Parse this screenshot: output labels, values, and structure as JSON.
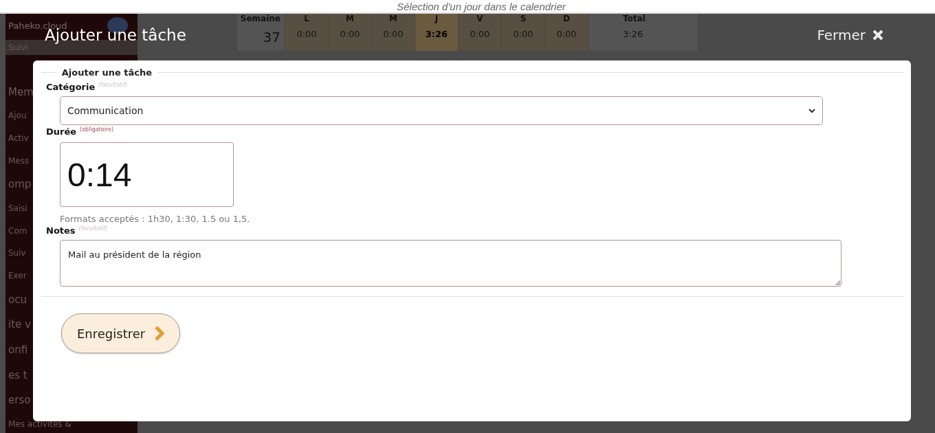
{
  "caption": "Sélection d'un jour dans le calendrier",
  "sidebar": {
    "brand": "Paheko.cloud",
    "items": [
      {
        "label": "Suivi",
        "kind": "item",
        "selected": true
      },
      {
        "label": "Mem",
        "kind": "section",
        "selected": false
      },
      {
        "label": "Ajou",
        "kind": "item",
        "selected": false
      },
      {
        "label": "Activ",
        "kind": "item",
        "selected": false
      },
      {
        "label": "Mess",
        "kind": "item",
        "selected": false
      },
      {
        "label": "omp",
        "kind": "section",
        "selected": false
      },
      {
        "label": "Saisi",
        "kind": "item",
        "selected": false
      },
      {
        "label": "Com",
        "kind": "item",
        "selected": false
      },
      {
        "label": "Suiv",
        "kind": "item",
        "selected": false
      },
      {
        "label": "Exer",
        "kind": "item",
        "selected": false
      },
      {
        "label": "ocu",
        "kind": "section",
        "selected": false
      },
      {
        "label": "ite v",
        "kind": "section",
        "selected": false
      },
      {
        "label": "onfi",
        "kind": "section",
        "selected": false
      },
      {
        "label": "es t",
        "kind": "section",
        "selected": false
      },
      {
        "label": "erso",
        "kind": "section",
        "selected": false
      },
      {
        "label": "Mes activités &",
        "kind": "item",
        "selected": false
      }
    ]
  },
  "week": {
    "columns": [
      {
        "head": "Semaine",
        "value": "37",
        "kind": "week",
        "selected": false
      },
      {
        "head": "L",
        "value": "0:00",
        "kind": "day",
        "selected": false
      },
      {
        "head": "M",
        "value": "0:00",
        "kind": "day",
        "selected": false
      },
      {
        "head": "M",
        "value": "0:00",
        "kind": "day",
        "selected": false
      },
      {
        "head": "J",
        "value": "3:26",
        "kind": "day",
        "selected": true
      },
      {
        "head": "V",
        "value": "0:00",
        "kind": "day",
        "selected": false
      },
      {
        "head": "S",
        "value": "0:00",
        "kind": "day",
        "selected": false
      },
      {
        "head": "D",
        "value": "0:00",
        "kind": "day",
        "selected": false
      },
      {
        "head": "Total",
        "value": "3:26",
        "kind": "total",
        "selected": false
      }
    ]
  },
  "dialog": {
    "title": "Ajouter une tâche",
    "close": "Fermer",
    "legend": "Ajouter une tâche",
    "category": {
      "label": "Catégorie",
      "note": "(facultatif)",
      "value": "Communication"
    },
    "duration": {
      "label": "Durée",
      "note": "(obligatoire)",
      "value": "0:14",
      "help": "Formats acceptés : 1h30, 1:30, 1.5 ou 1,5."
    },
    "notes": {
      "label": "Notes",
      "note": "(facultatif)",
      "value": "Mail au président de la région"
    },
    "submit": "Enregistrer"
  }
}
